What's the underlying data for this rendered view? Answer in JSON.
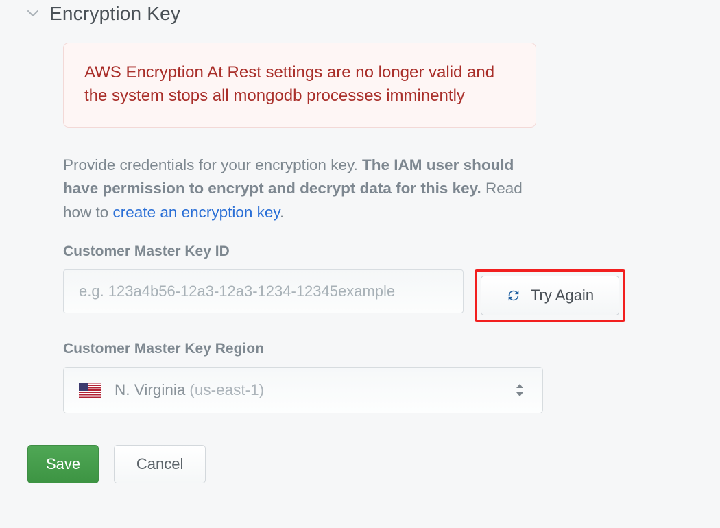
{
  "section": {
    "title": "Encryption Key"
  },
  "alert": {
    "message": "AWS Encryption At Rest settings are no longer valid and the system stops all mongodb processes imminently"
  },
  "help": {
    "lead": "Provide credentials for your encryption key. ",
    "emphasis": "The IAM user should have permission to encrypt and decrypt data for this key.",
    "tail": " Read how to ",
    "link_text": "create an encryption key",
    "period": "."
  },
  "fields": {
    "cmk_id": {
      "label": "Customer Master Key ID",
      "placeholder": "e.g. 123a4b56-12a3-12a3-1234-12345example",
      "value": ""
    },
    "region": {
      "label": "Customer Master Key Region",
      "selected_name": "N. Virginia",
      "selected_code": "(us-east-1)"
    }
  },
  "buttons": {
    "try_again": "Try Again",
    "save": "Save",
    "cancel": "Cancel"
  },
  "icons": {
    "chevron_down": "chevron-down",
    "refresh": "refresh",
    "us_flag": "us-flag"
  }
}
